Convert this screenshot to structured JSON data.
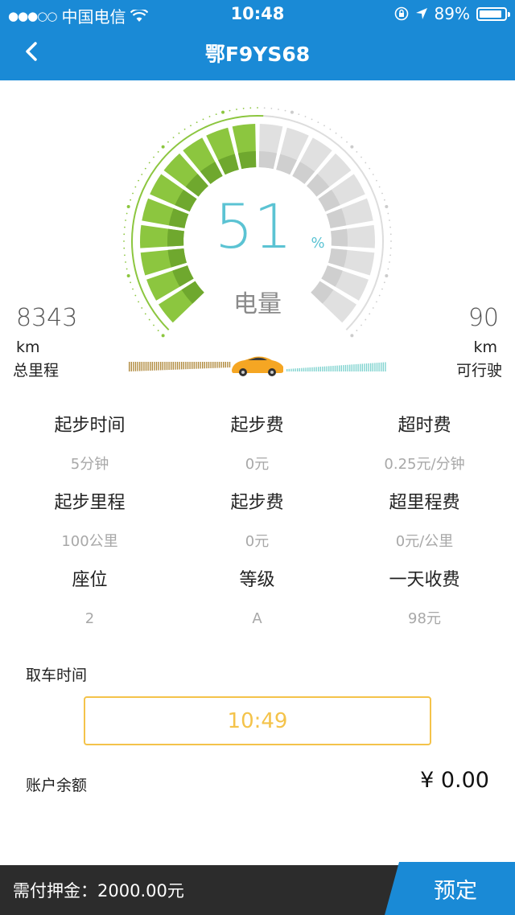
{
  "status_bar": {
    "carrier": "中国电信",
    "time": "10:48",
    "battery_text": "89%",
    "battery_level": 0.89,
    "signal_icon": "signal-dots-icon",
    "wifi_icon": "wifi-icon",
    "lock_icon": "rotation-lock-icon",
    "location_icon": "location-arrow-icon"
  },
  "nav": {
    "title": "鄂F9YS68",
    "back_icon": "chevron-left-icon"
  },
  "gauge": {
    "percent": "51",
    "percent_value": 51,
    "percent_symbol": "%",
    "label": "电量",
    "left_value": "8343",
    "left_unit": "km",
    "left_label": "总里程",
    "right_value": "90",
    "right_unit": "km",
    "right_label": "可行驶",
    "car_icon": "car-icon"
  },
  "fees": [
    [
      {
        "label": "起步时间",
        "value": "5分钟"
      },
      {
        "label": "起步费",
        "value": "0元"
      },
      {
        "label": "超时费",
        "value": "0.25元/分钟"
      }
    ],
    [
      {
        "label": "起步里程",
        "value": "100公里"
      },
      {
        "label": "起步费",
        "value": "0元"
      },
      {
        "label": "超里程费",
        "value": "0元/公里"
      }
    ],
    [
      {
        "label": "座位",
        "value": "2"
      },
      {
        "label": "等级",
        "value": "A"
      },
      {
        "label": "一天收费",
        "value": "98元"
      }
    ]
  ],
  "pickup": {
    "label": "取车时间",
    "time": "10:49"
  },
  "account": {
    "label": "账户余额",
    "balance": "¥ 0.00"
  },
  "footer": {
    "deposit": "需付押金：2000.00元",
    "reserve_label": "预定"
  },
  "colors": {
    "primary_blue": "#1a8ad6",
    "gauge_green": "#8cc63f",
    "gauge_gray": "#e0e0e0",
    "percent_teal": "#5bc3d3",
    "highlight_yellow": "#f4c34a",
    "footer_dark": "#2c2c2c"
  }
}
